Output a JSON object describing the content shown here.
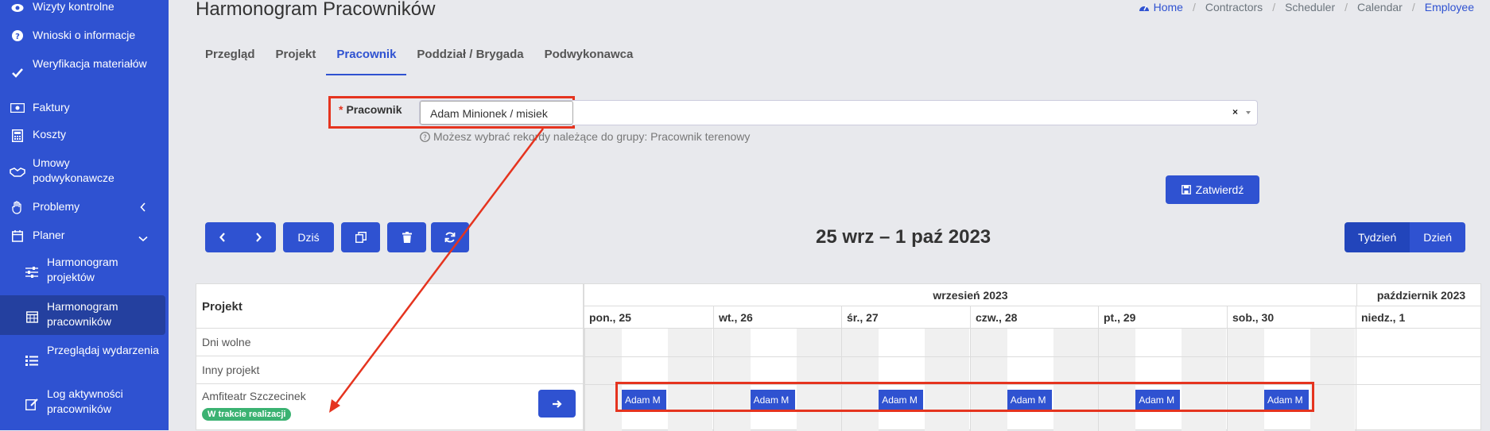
{
  "sidebar": {
    "items": [
      {
        "label": "Wizyty kontrolne",
        "icon": "eye-icon"
      },
      {
        "label": "Wnioski o informacje",
        "icon": "question-circle-icon"
      },
      {
        "label": "Weryfikacja materiałów",
        "icon": "check-icon"
      },
      {
        "label": "Faktury",
        "icon": "money-bill-icon"
      },
      {
        "label": "Koszty",
        "icon": "calculator-icon"
      },
      {
        "label": "Umowy podwykonawcze",
        "icon": "handshake-icon"
      },
      {
        "label": "Problemy",
        "icon": "hand-icon"
      },
      {
        "label": "Planer",
        "icon": "calendar-icon"
      },
      {
        "label": "Harmonogram projektów",
        "icon": "sliders-icon"
      },
      {
        "label": "Harmonogram pracowników",
        "icon": "calendar-grid-icon"
      },
      {
        "label": "Przeglądaj wydarzenia",
        "icon": "list-icon"
      },
      {
        "label": "Log aktywności pracowników",
        "icon": "edit-icon"
      }
    ]
  },
  "header": {
    "title": "Harmonogram Pracowników",
    "breadcrumb": [
      "Home",
      "Contractors",
      "Scheduler",
      "Calendar",
      "Employee"
    ]
  },
  "tabs": [
    "Przegląd",
    "Projekt",
    "Pracownik",
    "Poddział / Brygada",
    "Podwykonawca"
  ],
  "form": {
    "label": "Pracownik",
    "required_mark": "*",
    "selected": "Adam Minionek / misiek",
    "clear": "×",
    "hint": "Możesz wybrać rekordy należące do grupy: Pracownik terenowy",
    "submit": "Zatwierdź"
  },
  "toolbar": {
    "today": "Dziś",
    "range": "25 wrz – 1 paź 2023",
    "views": [
      "Tydzień",
      "Dzień"
    ]
  },
  "scheduler": {
    "resource_header": "Projekt",
    "months": [
      "wrzesień 2023",
      "październik 2023"
    ],
    "days": [
      "pon., 25",
      "wt., 26",
      "śr., 27",
      "czw., 28",
      "pt., 29",
      "sob., 30",
      "niedz., 1"
    ],
    "rows": [
      {
        "name": "Dni wolne"
      },
      {
        "name": "Inny projekt"
      },
      {
        "name": "Amfiteatr Szczecinek",
        "status": "W trakcie realizacji"
      }
    ],
    "event_label": "Adam M"
  },
  "colors": {
    "primary": "#2f52d1",
    "sidebar": "#2f52d1",
    "highlight": "#e5341f",
    "status": "#3bb272"
  }
}
